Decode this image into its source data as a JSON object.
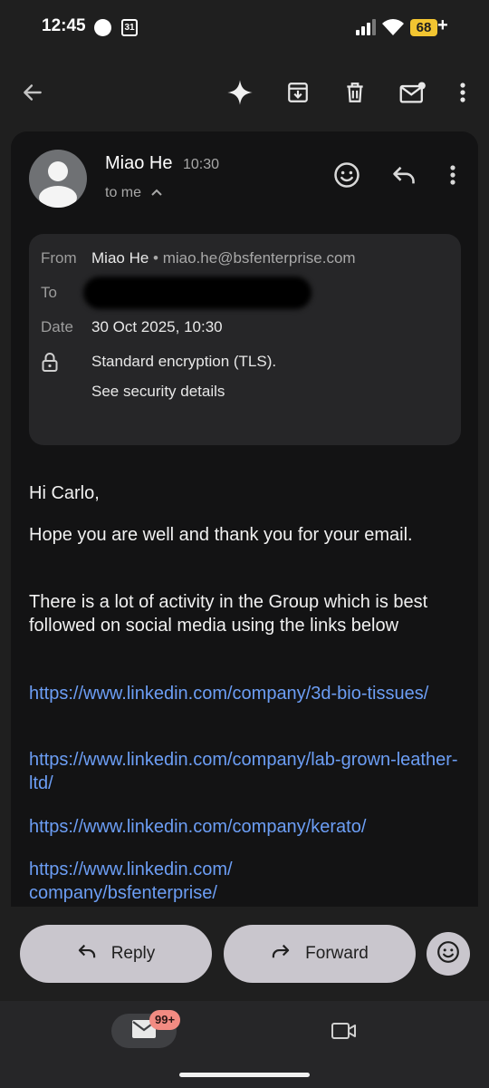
{
  "status_bar": {
    "time": "12:45",
    "calendar_day": "31",
    "battery": "68",
    "battery_suffix": "+"
  },
  "app_bar": {
    "icons": [
      "back-arrow-icon",
      "sparkle-icon",
      "archive-icon",
      "delete-icon",
      "mark-unread-icon",
      "more-vert-icon"
    ]
  },
  "message": {
    "sender_name": "Miao He",
    "time": "10:30",
    "to_line": "to me",
    "details": {
      "from_label": "From",
      "from_name": "Miao He",
      "from_email": " • miao.he@bsfenterprise.com",
      "to_label": "To",
      "date_label": "Date",
      "date_value": "30 Oct 2025, 10:30",
      "encryption": "Standard encryption (TLS).",
      "security_link": "See security details"
    },
    "body": {
      "greeting": "Hi Carlo,",
      "paragraph1": "Hope you are well and thank you for your email.",
      "paragraph2": "There is a lot of activity in the Group which is best followed on social media using the links below",
      "links": [
        "https://www.linkedin.com/company/3d-bio-tissues/",
        "https://www.linkedin.com/company/lab-grown-leather-ltd/",
        "https://www.linkedin.com/company/kerato/",
        "https://www.linkedin.com/ company/bsfenterprise/"
      ]
    }
  },
  "actions": {
    "reply_label": "Reply",
    "forward_label": "Forward"
  },
  "bottom_nav": {
    "mail_badge": "99+"
  },
  "colors": {
    "background": "#1f1f1f",
    "card": "#131314",
    "details_box": "#262628",
    "link": "#6c9ef5",
    "action_button": "#c9c6cd",
    "badge": "#f28b82",
    "battery": "#f2c531"
  }
}
